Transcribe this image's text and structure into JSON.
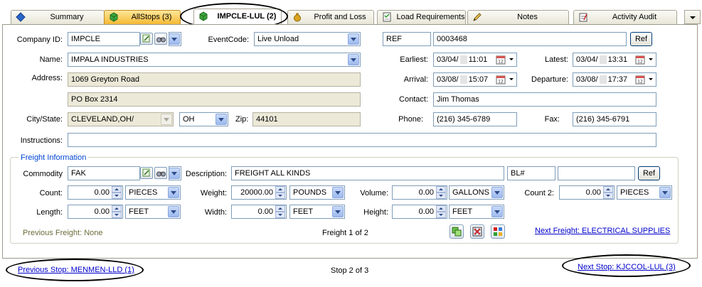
{
  "tabs": [
    {
      "label": "Summary",
      "icon": "blue-diamond-icon"
    },
    {
      "label": "AllStops (3)",
      "icon": "green-cube-icon"
    },
    {
      "label": "IMPCLE-LUL (2)",
      "icon": "green-cube-icon",
      "active": true
    },
    {
      "label": "Profit and Loss",
      "icon": "money-bag-icon"
    },
    {
      "label": "Load Requirements",
      "icon": "checklist-icon"
    },
    {
      "label": "Notes",
      "icon": "pencil-icon"
    },
    {
      "label": "Activity Audit",
      "icon": "audit-clipboard-icon"
    }
  ],
  "stop": {
    "company_id_label": "Company ID:",
    "company_id": "IMPCLE",
    "event_code_label": "EventCode:",
    "event_code": "Live Unload",
    "ref_type": "REF",
    "ref_value": "0003468",
    "ref_button": "Ref",
    "name_label": "Name:",
    "name": "IMPALA INDUSTRIES",
    "address_label": "Address:",
    "address1": "1069 Greyton Road",
    "address2": "PO Box 2314",
    "city_state_label": "City/State:",
    "city_state": "CLEVELAND,OH/",
    "state": "OH",
    "zip_label": "Zip:",
    "zip": "44101",
    "instructions_label": "Instructions:",
    "instructions": "",
    "earliest_label": "Earliest:",
    "earliest_date": "03/04/",
    "earliest_time": "11:01",
    "latest_label": "Latest:",
    "latest_date": "03/04/",
    "latest_time": "13:31",
    "arrival_label": "Arrival:",
    "arrival_date": "03/08/",
    "arrival_time": "15:07",
    "departure_label": "Departure:",
    "departure_date": "03/08/",
    "departure_time": "17:37",
    "contact_label": "Contact:",
    "contact": "Jim Thomas",
    "phone_label": "Phone:",
    "phone": "(216) 345-6789",
    "fax_label": "Fax:",
    "fax": "(216) 345-6791"
  },
  "freight": {
    "group_title": "Freight Information",
    "commodity_label": "Commodity",
    "commodity": "FAK",
    "description_label": "Description:",
    "description": "FREIGHT ALL KINDS",
    "bl_type": "BL#",
    "bl_value": "",
    "ref_button": "Ref",
    "count_label": "Count:",
    "count": "0.00",
    "count_unit": "PIECES",
    "weight_label": "Weight:",
    "weight": "20000.00",
    "weight_unit": "POUNDS",
    "volume_label": "Volume:",
    "volume": "0.00",
    "volume_unit": "GALLONS",
    "count2_label": "Count 2:",
    "count2": "0.00",
    "count2_unit": "PIECES",
    "length_label": "Length:",
    "length": "0.00",
    "length_unit": "FEET",
    "width_label": "Width:",
    "width": "0.00",
    "width_unit": "FEET",
    "height_label": "Height:",
    "height": "0.00",
    "height_unit": "FEET",
    "previous_freight": "Previous Freight: None",
    "freight_position": "Freight 1 of 2",
    "next_freight": "Next Freight: ELECTRICAL SUPPLIES"
  },
  "nav": {
    "previous_stop": "Previous Stop: MENMEN-LLD (1)",
    "stop_position": "Stop 2 of 3",
    "next_stop": "Next Stop: KJCCOL-LUL (3)"
  }
}
